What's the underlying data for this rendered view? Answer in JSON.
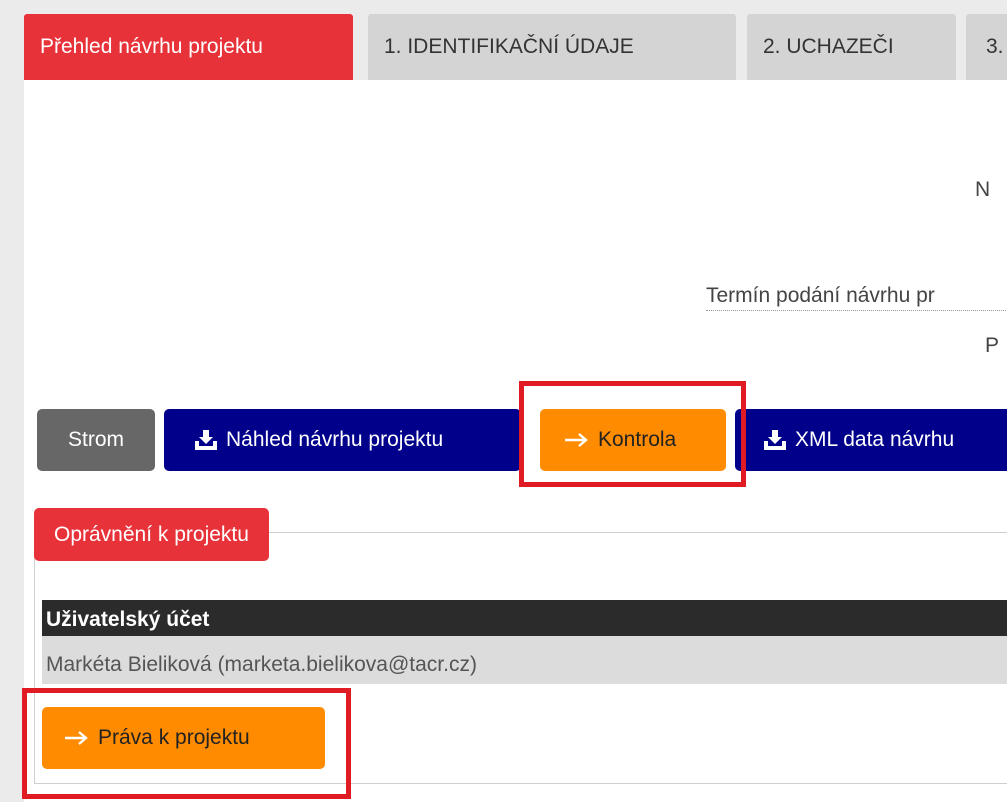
{
  "tabs": [
    {
      "label": "Přehled návrhu projektu",
      "active": true
    },
    {
      "label": "1. IDENTIFIKAČNÍ ÚDAJE",
      "active": false
    },
    {
      "label": "2. UCHAZEČI",
      "active": false
    },
    {
      "label": "3.",
      "active": false
    }
  ],
  "info": {
    "line1": "N",
    "line2": "Termín podání návrhu pr",
    "line3": "P"
  },
  "toolbar": {
    "tree_label": "Strom",
    "preview_label": "Náhled návrhu projektu",
    "check_label": "Kontrola",
    "xml_label": "XML data návrhu"
  },
  "permissions": {
    "legend": "Oprávnění k projektu",
    "column_header": "Uživatelský účet",
    "rows": [
      "Markéta Bieliková (marketa.bielikova@tacr.cz)"
    ],
    "rights_button_label": "Práva k projektu"
  },
  "icons": {
    "download": "download-icon",
    "arrow": "arrow-right-icon"
  },
  "colors": {
    "accent_red": "#e8323a",
    "navy": "#00008b",
    "orange": "#ff8c00",
    "gray_button": "#676767",
    "highlight_box": "#e01b24"
  }
}
